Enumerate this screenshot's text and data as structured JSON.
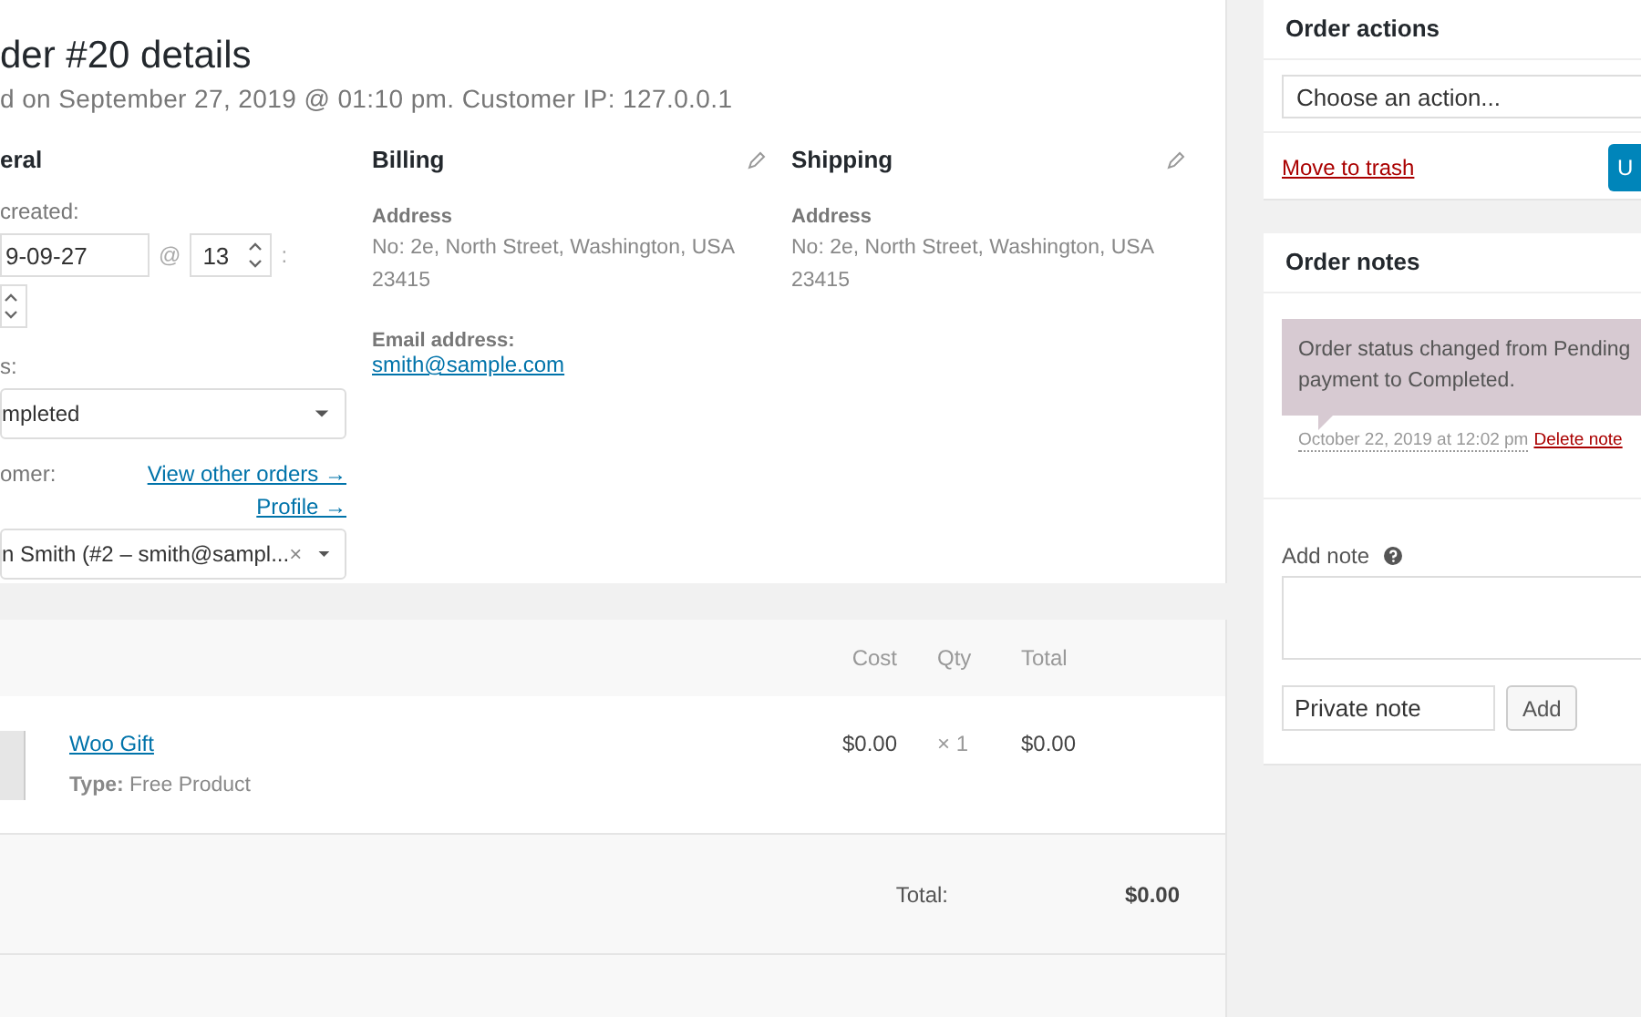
{
  "header": {
    "title": "der #20 details",
    "subtitle": "d on September 27, 2019 @ 01:10 pm. Customer IP: 127.0.0.1"
  },
  "general": {
    "heading": "eral",
    "date_label": "created:",
    "date_value": "9-09-27",
    "at": "@",
    "hour": "13",
    "colon": ":",
    "status_label": "s:",
    "status_value": "mpleted",
    "customer_label": "omer:",
    "links": [
      "View other orders →",
      "Profile →"
    ],
    "customer_value": "n Smith (#2 – smith@sampl...",
    "clear": "×"
  },
  "billing": {
    "heading": "Billing",
    "address_label": "Address",
    "address_lines": [
      "No: 2e, North Street, Washington, USA",
      "23415"
    ],
    "email_label": "Email address:",
    "email": "smith@sample.com"
  },
  "shipping": {
    "heading": "Shipping",
    "address_label": "Address",
    "address_lines": [
      "No: 2e, North Street, Washington, USA",
      "23415"
    ]
  },
  "items": {
    "columns": [
      "Cost",
      "Qty",
      "Total"
    ],
    "rows": [
      {
        "name": "Woo Gift",
        "meta_label": "Type:",
        "meta_value": "Free Product",
        "cost": "$0.00",
        "qty": "× 1",
        "total": "$0.00"
      }
    ],
    "totals": [
      {
        "label": "Total:",
        "value": "$0.00"
      }
    ]
  },
  "order_actions": {
    "title": "Order actions",
    "select": "Choose an action...",
    "trash": "Move to trash",
    "button": "U"
  },
  "order_notes": {
    "title": "Order notes",
    "notes": [
      {
        "text": "Order status changed from Pending payment to Completed.",
        "date": "October 22, 2019 at 12:02 pm",
        "delete": "Delete note"
      }
    ],
    "add_label": "Add note",
    "note_type": "Private note",
    "add_button": "Add"
  }
}
